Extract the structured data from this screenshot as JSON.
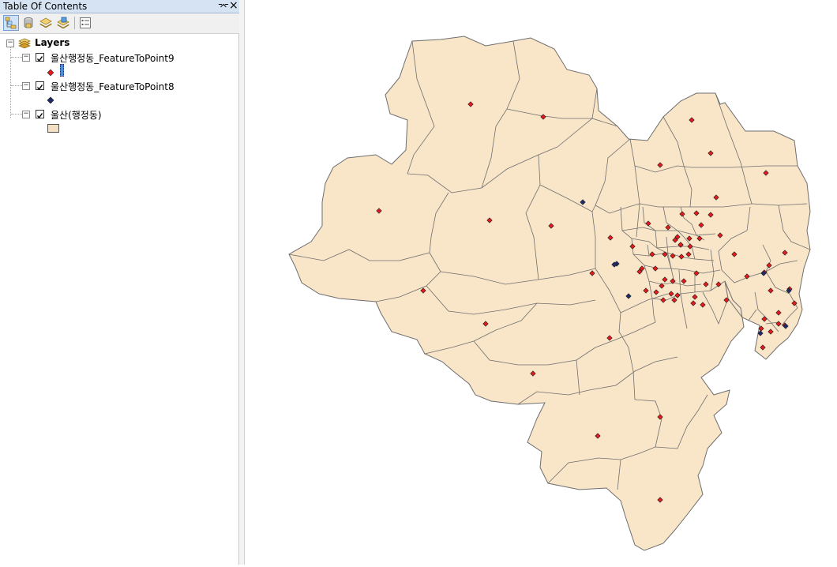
{
  "toc": {
    "title": "Table Of Contents",
    "pin_glyph": "⌤",
    "close_glyph": "×",
    "tools": [
      {
        "icon": "list-by-drawing-order-icon"
      },
      {
        "icon": "list-by-source-icon"
      },
      {
        "icon": "list-by-visibility-icon"
      },
      {
        "icon": "list-by-selection-icon"
      },
      {
        "icon": "options-icon"
      }
    ],
    "root_label": "Layers",
    "layers": [
      {
        "name": "울산행정동_FeatureToPoint9",
        "checked": true,
        "symbol": "red-diamond",
        "symbol_color": "#e31a1c"
      },
      {
        "name": "울산행정동_FeatureToPoint8",
        "checked": true,
        "symbol": "navy-diamond",
        "symbol_color": "#1f2a6b"
      },
      {
        "name": "울산(행정동)",
        "checked": true,
        "symbol": "polygon-fill",
        "symbol_color": "#f5dfc1"
      }
    ]
  },
  "map": {
    "fill_color": "#f9e5c8",
    "outline_color": "#6e6e6e",
    "red_point_color": "#e31a1c",
    "navy_point_color": "#1f2a6b",
    "red_points_count": 74,
    "navy_points_count": 8
  }
}
